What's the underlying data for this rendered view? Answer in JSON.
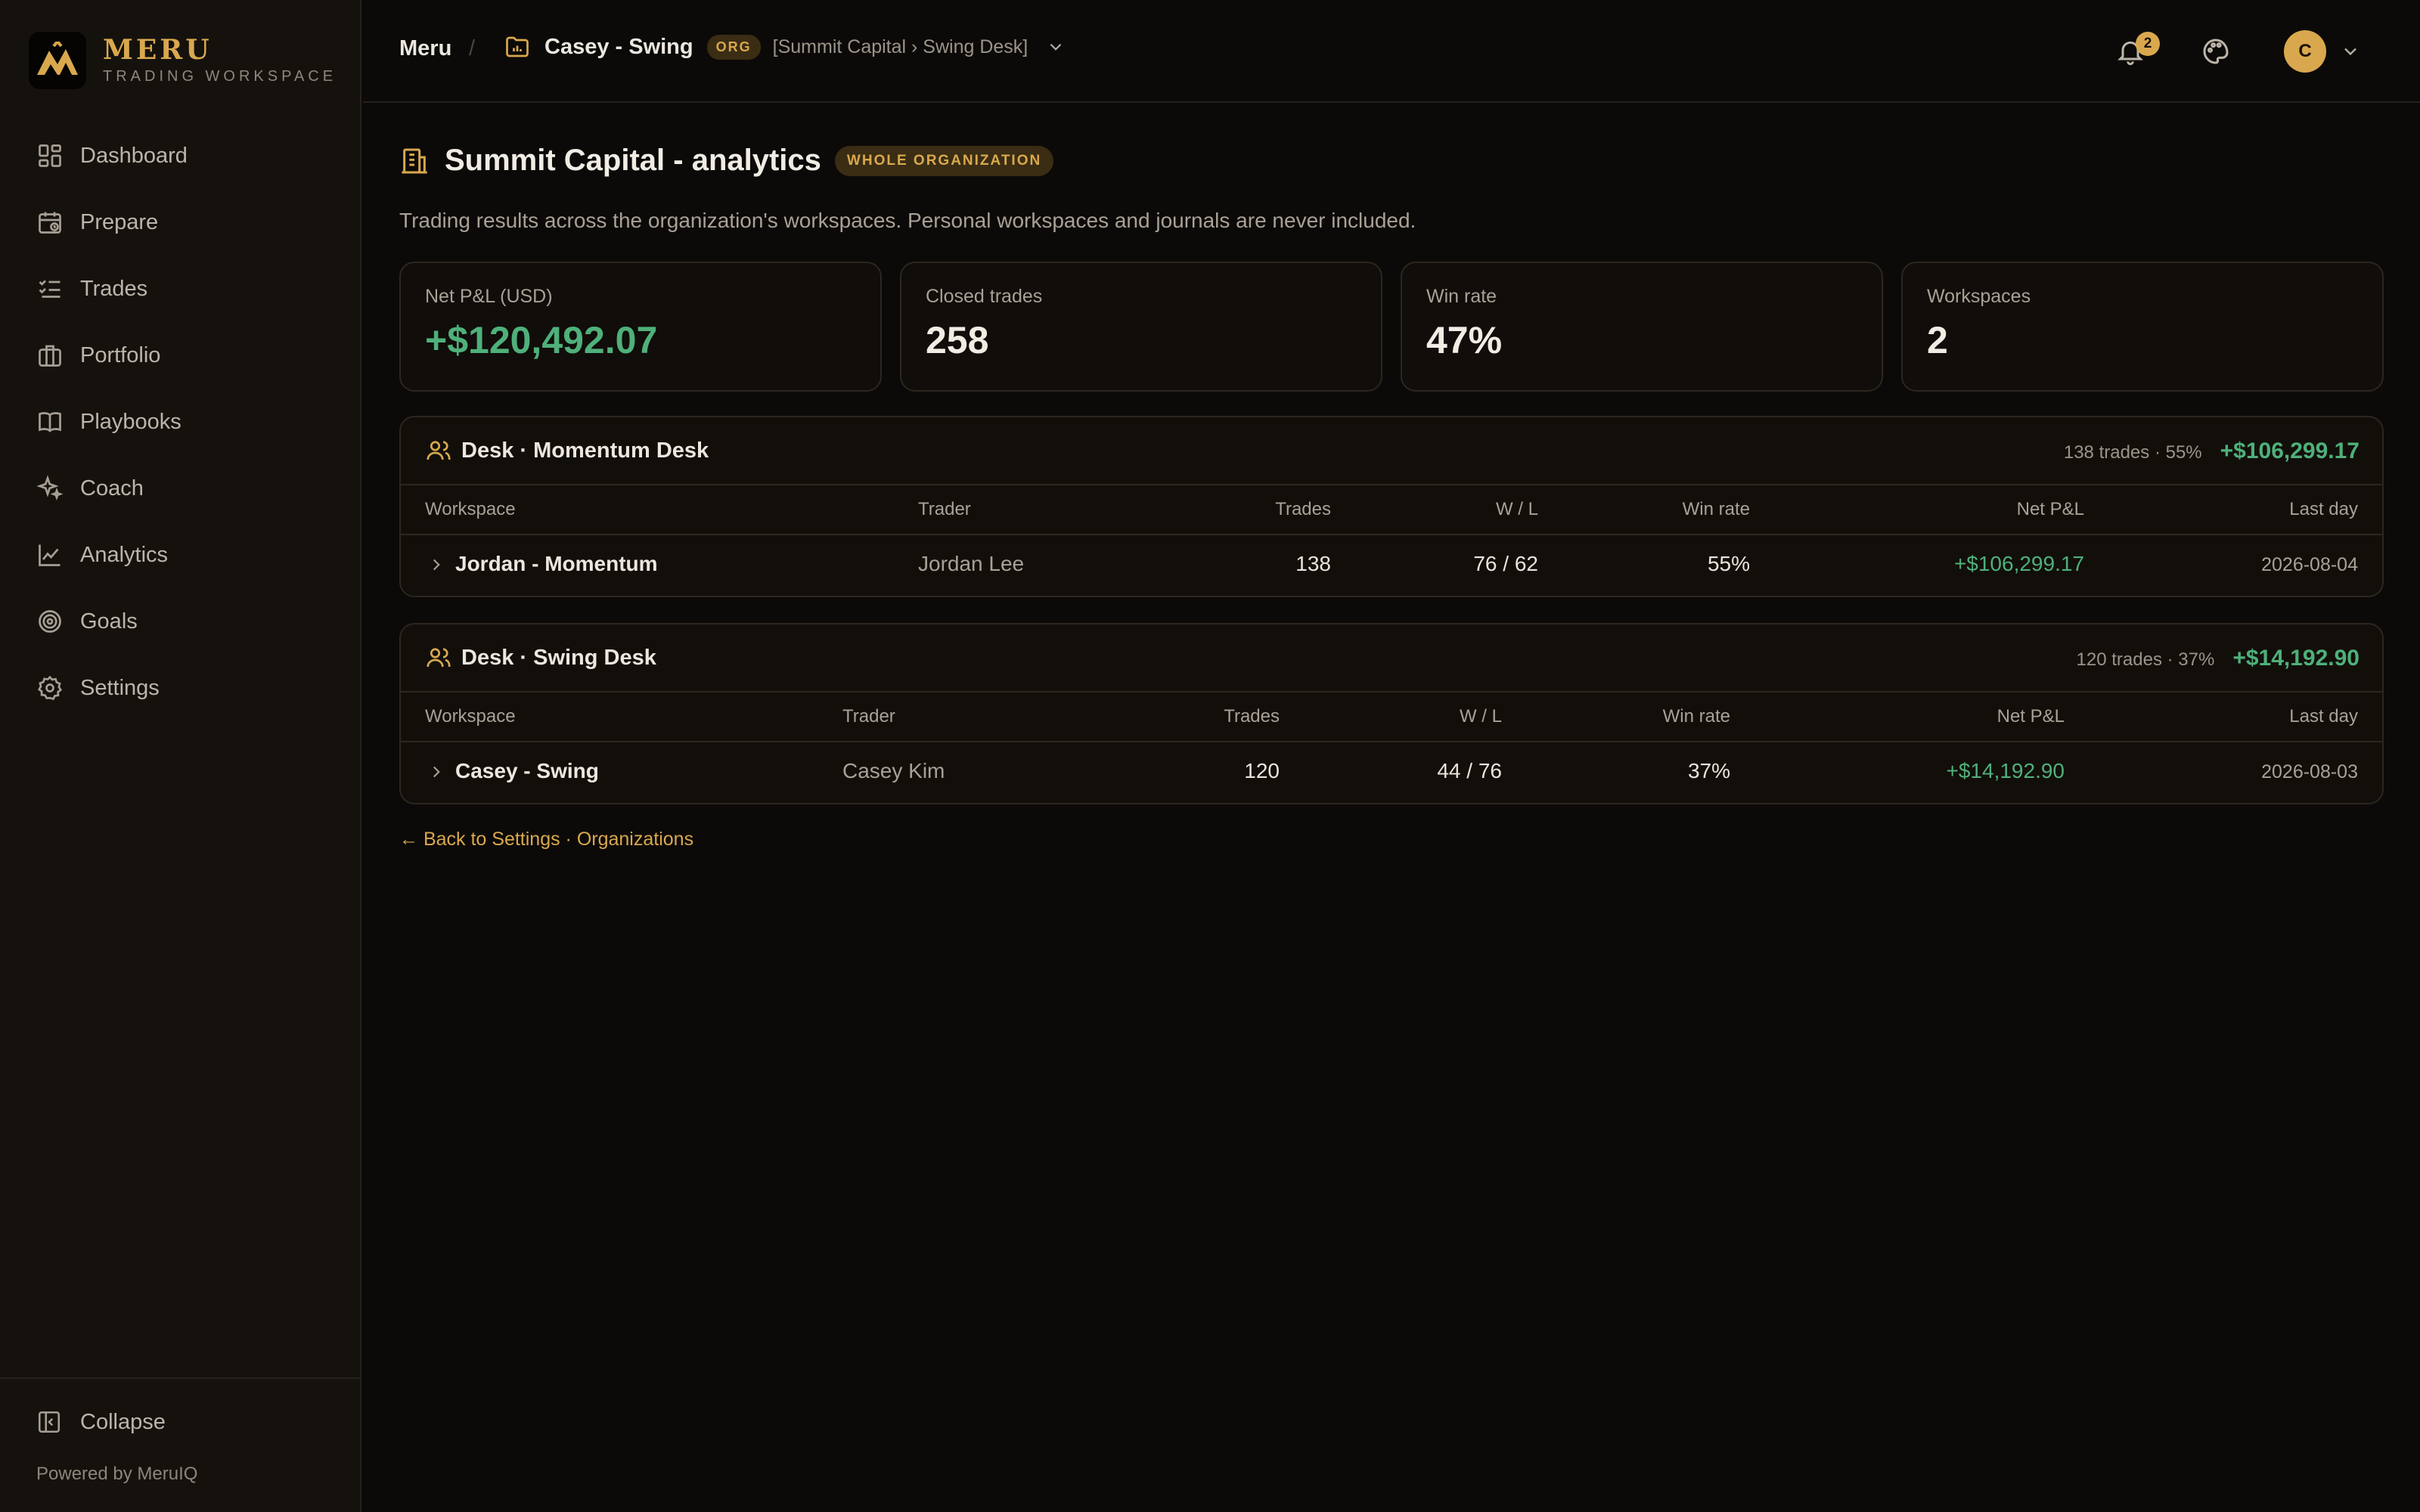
{
  "brand": {
    "name": "MERU",
    "subtitle": "TRADING WORKSPACE"
  },
  "sidebar": {
    "items": [
      {
        "label": "Dashboard",
        "icon": "dashboard-icon"
      },
      {
        "label": "Prepare",
        "icon": "calendar-icon"
      },
      {
        "label": "Trades",
        "icon": "list-check-icon"
      },
      {
        "label": "Portfolio",
        "icon": "briefcase-icon"
      },
      {
        "label": "Playbooks",
        "icon": "book-icon"
      },
      {
        "label": "Coach",
        "icon": "sparkles-icon"
      },
      {
        "label": "Analytics",
        "icon": "line-chart-icon"
      },
      {
        "label": "Goals",
        "icon": "target-icon"
      },
      {
        "label": "Settings",
        "icon": "gear-icon"
      }
    ],
    "collapse_label": "Collapse",
    "powered_by": "Powered by MeruIQ"
  },
  "topbar": {
    "root": "Meru",
    "separator": "/",
    "workspace_name": "Casey - Swing",
    "org_badge": "ORG",
    "workspace_path": "[Summit Capital › Swing Desk]",
    "notification_count": "2",
    "avatar_initial": "C"
  },
  "page": {
    "title": "Summit Capital - analytics",
    "scope_badge": "WHOLE ORGANIZATION",
    "subtitle": "Trading results across the organization's workspaces. Personal workspaces and journals are never included."
  },
  "kpis": [
    {
      "label": "Net P&L (USD)",
      "value": "+$120,492.07",
      "positive": true
    },
    {
      "label": "Closed trades",
      "value": "258"
    },
    {
      "label": "Win rate",
      "value": "47%"
    },
    {
      "label": "Workspaces",
      "value": "2"
    }
  ],
  "desks": [
    {
      "title": "Desk · Momentum Desk",
      "stats": "138 trades · 55%",
      "pnl": "+$106,299.17",
      "columns": [
        "Workspace",
        "Trader",
        "Trades",
        "W / L",
        "Win rate",
        "Net P&L",
        "Last day"
      ],
      "rows": [
        {
          "workspace": "Jordan - Momentum",
          "trader": "Jordan Lee",
          "trades": "138",
          "wl": "76 / 62",
          "win_rate": "55%",
          "pnl": "+$106,299.17",
          "last_day": "2026-08-04"
        }
      ]
    },
    {
      "title": "Desk · Swing Desk",
      "stats": "120 trades · 37%",
      "pnl": "+$14,192.90",
      "columns": [
        "Workspace",
        "Trader",
        "Trades",
        "W / L",
        "Win rate",
        "Net P&L",
        "Last day"
      ],
      "rows": [
        {
          "workspace": "Casey - Swing",
          "trader": "Casey Kim",
          "trades": "120",
          "wl": "44 / 76",
          "win_rate": "37%",
          "pnl": "+$14,192.90",
          "last_day": "2026-08-03"
        }
      ]
    }
  ],
  "back_link": "← Back to Settings · Organizations",
  "colors": {
    "accent": "#d9a84e",
    "positive": "#4fb07a",
    "background": "#0c0a08",
    "sidebar": "#15120e"
  }
}
